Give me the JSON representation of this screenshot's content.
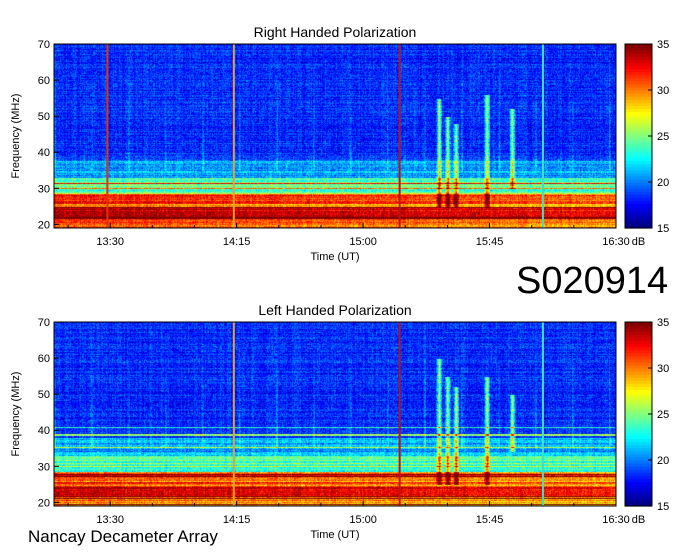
{
  "observation_id": "S020914",
  "instrument": "Nancay Decameter Array",
  "chart_data": [
    {
      "type": "heatmap",
      "title": "Right Handed Polarization",
      "xlabel": "Time (UT)",
      "ylabel": "Frequency (MHz)",
      "x_ticks": [
        "13:30",
        "14:15",
        "15:00",
        "15:45",
        "16:30"
      ],
      "x_range": [
        "13:10",
        "16:30"
      ],
      "ylim": [
        19,
        70
      ],
      "y_ticks": [
        20,
        30,
        40,
        50,
        60,
        70
      ],
      "colorbar": {
        "label": "dB",
        "range": [
          15,
          35
        ],
        "ticks": [
          15,
          20,
          25,
          30,
          35
        ]
      },
      "vertical_lines": [
        {
          "time": "13:29",
          "color": "#e03010"
        },
        {
          "time": "14:14",
          "color": "#e8a030"
        },
        {
          "time": "15:13",
          "color": "#c01010"
        },
        {
          "time": "16:04",
          "color": "#40e0c0"
        }
      ],
      "bursts": [
        {
          "time": "15:27",
          "f_low": 25,
          "f_high": 55
        },
        {
          "time": "15:30",
          "f_low": 25,
          "f_high": 50
        },
        {
          "time": "15:33",
          "f_low": 25,
          "f_high": 48
        },
        {
          "time": "15:44",
          "f_low": 25,
          "f_high": 56
        },
        {
          "time": "15:53",
          "f_low": 30,
          "f_high": 52
        }
      ]
    },
    {
      "type": "heatmap",
      "title": "Left Handed Polarization",
      "xlabel": "Time (UT)",
      "ylabel": "Frequency (MHz)",
      "x_ticks": [
        "13:30",
        "14:15",
        "15:00",
        "15:45",
        "16:30"
      ],
      "x_range": [
        "13:10",
        "16:30"
      ],
      "ylim": [
        19,
        70
      ],
      "y_ticks": [
        20,
        30,
        40,
        50,
        60,
        70
      ],
      "colorbar": {
        "label": "dB",
        "range": [
          15,
          35
        ],
        "ticks": [
          15,
          20,
          25,
          30,
          35
        ]
      },
      "vertical_lines": [
        {
          "time": "14:14",
          "color": "#e8a030"
        },
        {
          "time": "15:13",
          "color": "#c01010"
        },
        {
          "time": "16:04",
          "color": "#40e0c0"
        }
      ],
      "bursts": [
        {
          "time": "15:27",
          "f_low": 25,
          "f_high": 60
        },
        {
          "time": "15:30",
          "f_low": 25,
          "f_high": 55
        },
        {
          "time": "15:33",
          "f_low": 25,
          "f_high": 52
        },
        {
          "time": "15:44",
          "f_low": 25,
          "f_high": 55
        },
        {
          "time": "15:53",
          "f_low": 34,
          "f_high": 50
        }
      ]
    }
  ]
}
